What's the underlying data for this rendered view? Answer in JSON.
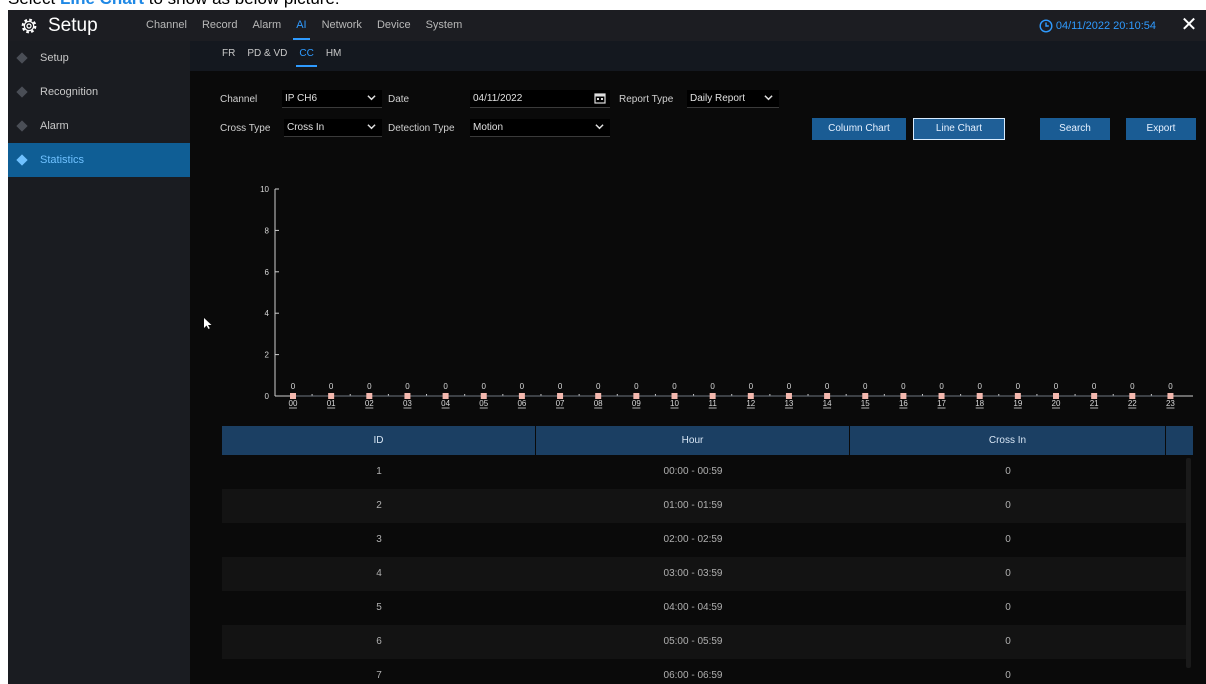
{
  "caption": {
    "prefix": "Select ",
    "highlight": "Line Chart",
    "suffix": " to show as below picture:"
  },
  "header": {
    "title": "Setup",
    "nav": [
      "Channel",
      "Record",
      "Alarm",
      "AI",
      "Network",
      "Device",
      "System"
    ],
    "active_nav": "AI",
    "datetime": "04/11/2022 20:10:54"
  },
  "sidebar": {
    "items": [
      {
        "label": "Setup",
        "active": false
      },
      {
        "label": "Recognition",
        "active": false
      },
      {
        "label": "Alarm",
        "active": false
      },
      {
        "label": "Statistics",
        "active": true
      }
    ]
  },
  "subtabs": {
    "items": [
      "FR",
      "PD & VD",
      "CC",
      "HM"
    ],
    "active": "CC"
  },
  "form": {
    "channel_label": "Channel",
    "channel_value": "IP CH6",
    "date_label": "Date",
    "date_value": "04/11/2022",
    "report_type_label": "Report Type",
    "report_type_value": "Daily Report",
    "cross_type_label": "Cross Type",
    "cross_type_value": "Cross In",
    "detection_type_label": "Detection Type",
    "detection_type_value": "Motion",
    "column_chart_label": "Column Chart",
    "line_chart_label": "Line Chart",
    "search_label": "Search",
    "export_label": "Export"
  },
  "colors": {
    "accent": "#2f9bff",
    "active_sidebar": "#0f5e95",
    "button": "#1a5c94",
    "table_header": "#1b3f63",
    "point": "#f4b8ae"
  },
  "chart_data": {
    "type": "line",
    "x": [
      "00",
      "01",
      "02",
      "03",
      "04",
      "05",
      "06",
      "07",
      "08",
      "09",
      "10",
      "11",
      "12",
      "13",
      "14",
      "15",
      "16",
      "17",
      "18",
      "19",
      "20",
      "21",
      "22",
      "23"
    ],
    "series": [
      {
        "values": [
          0,
          0,
          0,
          0,
          0,
          0,
          0,
          0,
          0,
          0,
          0,
          0,
          0,
          0,
          0,
          0,
          0,
          0,
          0,
          0,
          0,
          0,
          0,
          0
        ]
      }
    ],
    "yticks": [
      0,
      2,
      4,
      6,
      8,
      10
    ],
    "ylim": [
      0,
      10
    ],
    "title": "",
    "xlabel": "",
    "ylabel": ""
  },
  "table": {
    "headers": [
      "ID",
      "Hour",
      "Cross In"
    ],
    "rows": [
      [
        "1",
        "00:00 - 00:59",
        "0"
      ],
      [
        "2",
        "01:00 - 01:59",
        "0"
      ],
      [
        "3",
        "02:00 - 02:59",
        "0"
      ],
      [
        "4",
        "03:00 - 03:59",
        "0"
      ],
      [
        "5",
        "04:00 - 04:59",
        "0"
      ],
      [
        "6",
        "05:00 - 05:59",
        "0"
      ],
      [
        "7",
        "06:00 - 06:59",
        "0"
      ]
    ]
  }
}
